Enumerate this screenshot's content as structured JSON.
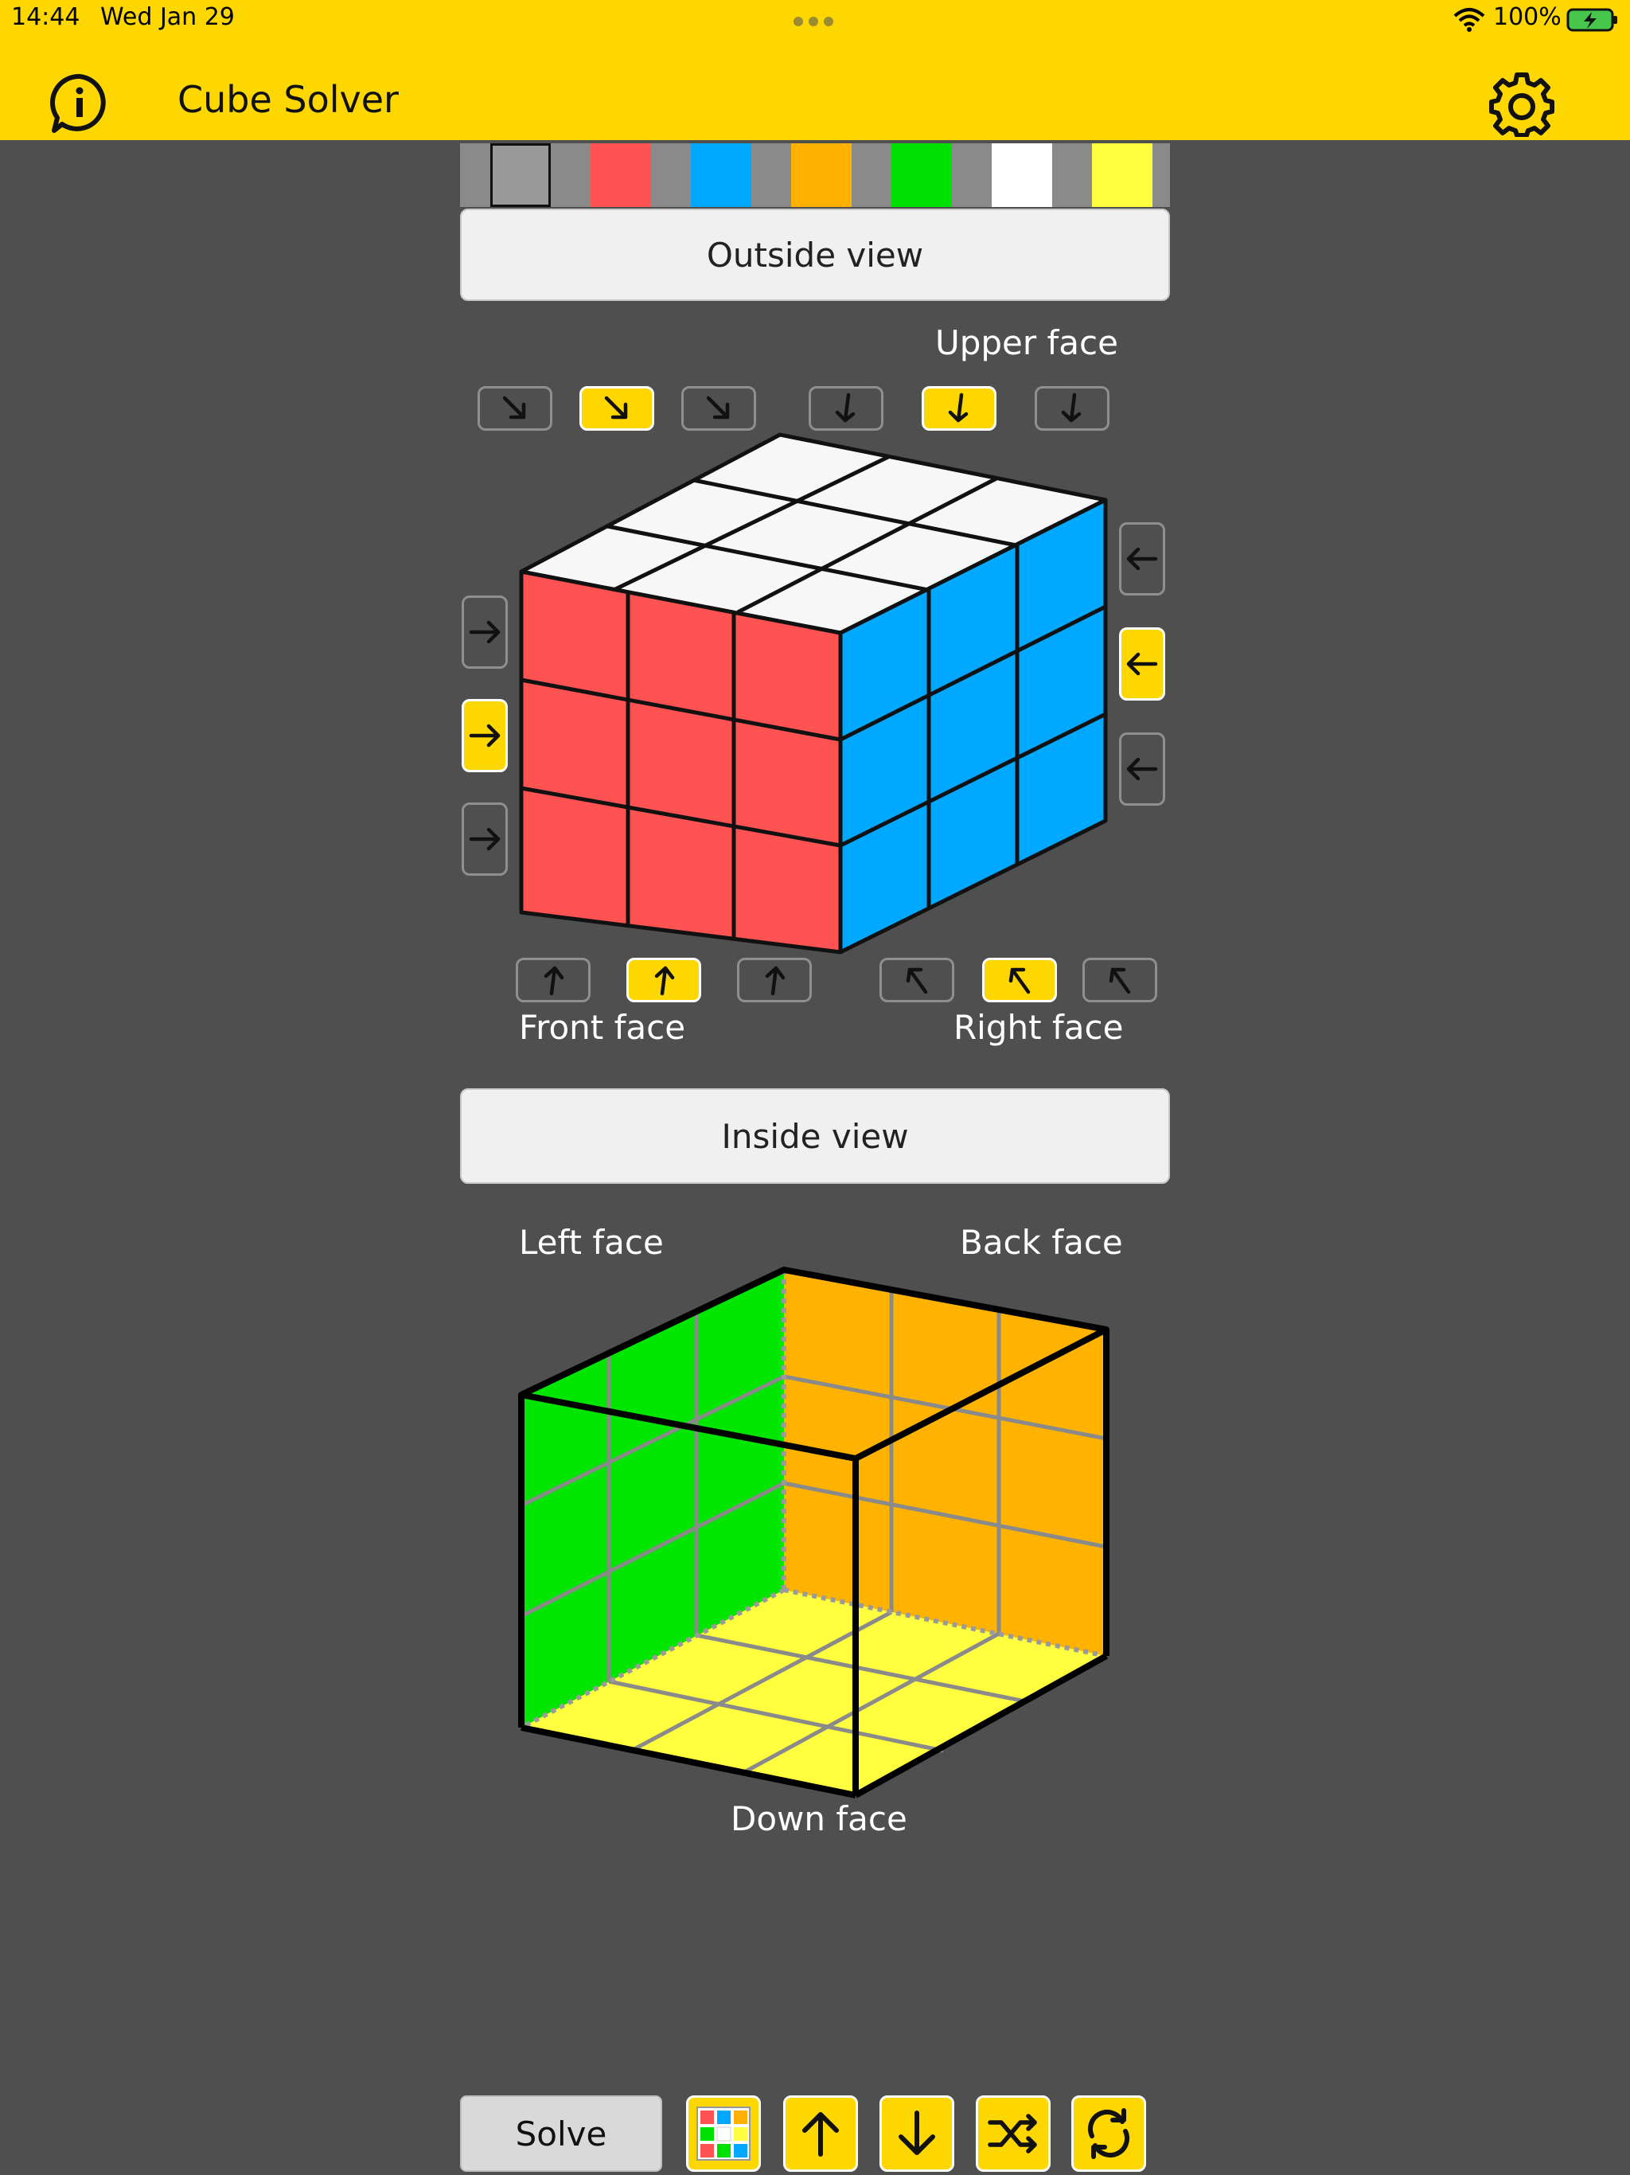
{
  "status_bar": {
    "time": "14:44",
    "date": "Wed Jan 29",
    "battery": "100%"
  },
  "header": {
    "title": "Cube Solver",
    "info_icon": "info-icon",
    "settings_icon": "gear-icon",
    "background_color": "#ffd700"
  },
  "palette": {
    "colors": [
      "#999999",
      "#ff5252",
      "#00a8ff",
      "#ffb000",
      "#00e000",
      "#ffffff",
      "#ffff40"
    ],
    "selected_index": 0
  },
  "outside_view": {
    "button_label": "Outside view",
    "upper_face_label": "Upper face",
    "front_face_label": "Front face",
    "right_face_label": "Right face",
    "upper_face_color": "#f7f7f7",
    "front_face_color": "#ff5252",
    "right_face_color": "#00a8ff",
    "top_arrows_active": [
      1,
      4
    ],
    "left_arrows_active": [
      1
    ],
    "right_arrows_active": [
      1
    ],
    "bottom_arrows_active": [
      1,
      4
    ]
  },
  "inside_view": {
    "button_label": "Inside view",
    "left_face_label": "Left face",
    "back_face_label": "Back face",
    "down_face_label": "Down face",
    "left_face_color": "#00e600",
    "back_face_color": "#ffb300",
    "down_face_color": "#ffff40"
  },
  "toolbar": {
    "solve_label": "Solve",
    "icons": [
      "color-grid-icon",
      "arrow-up-icon",
      "arrow-down-icon",
      "shuffle-icon",
      "refresh-icon"
    ]
  }
}
